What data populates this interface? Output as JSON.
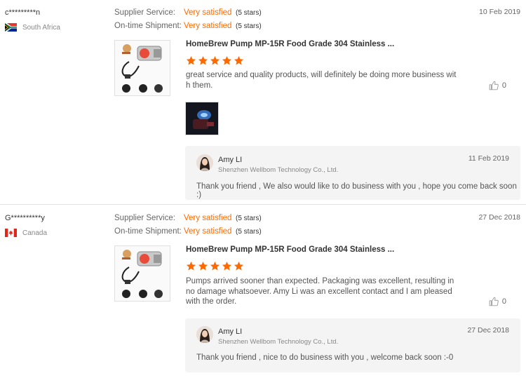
{
  "reviews": [
    {
      "buyer_name": "c*********n",
      "country": "South Africa",
      "supplier_service_label": "Supplier Service:",
      "supplier_service_value": "Very satisfied",
      "supplier_service_stars": "(5 stars)",
      "shipment_label": "On-time Shipment:",
      "shipment_value": "Very satisfied",
      "shipment_stars": "(5 stars)",
      "date": "10 Feb 2019",
      "product_title": "HomeBrew Pump MP-15R Food Grade 304 Stainless ...",
      "rating": 5,
      "text": "great service and quality products, will definitely be doing more business with them.",
      "likes": "0",
      "has_photo": true,
      "reply": {
        "name": "Amy LI",
        "company": "Shenzhen Wellbom Technology Co., Ltd.",
        "date": "11 Feb 2019",
        "text": "Thank you friend , We also would like to do business with you , hope you come back soon :)"
      }
    },
    {
      "buyer_name": "G**********y",
      "country": "Canada",
      "supplier_service_label": "Supplier Service:",
      "supplier_service_value": "Very satisfied",
      "supplier_service_stars": "(5 stars)",
      "shipment_label": "On-time Shipment:",
      "shipment_value": "Very satisfied",
      "shipment_stars": "(5 stars)",
      "date": "27 Dec 2018",
      "product_title": "HomeBrew Pump MP-15R Food Grade 304 Stainless ...",
      "rating": 5,
      "text": "Pumps arrived sooner than expected.  Packaging was excellent, resulting in no damage whatsoever.  Amy Li was an excellent contact and I am pleased with the order.",
      "likes": "0",
      "has_photo": false,
      "reply": {
        "name": "Amy LI",
        "company": "Shenzhen Wellbom Technology Co., Ltd.",
        "date": "27 Dec 2018",
        "text": "Thank you friend , nice to do business with you , welcome back soon :-0"
      }
    }
  ],
  "colors": {
    "accent": "#ff6a00",
    "reply_bg": "#f4f4f4"
  },
  "icons": {
    "star": "star-icon",
    "like": "thumbs-up-icon"
  }
}
